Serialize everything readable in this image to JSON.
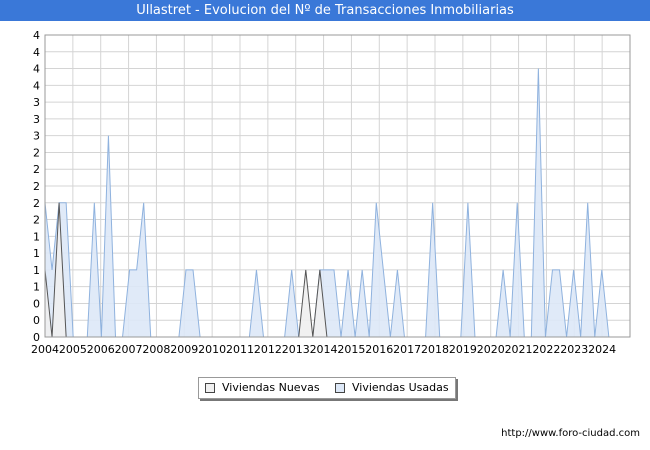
{
  "header": {
    "title": "Ullastret - Evolucion del Nº de Transacciones Inmobiliarias"
  },
  "legend": {
    "nuevas_label": "Viviendas Nuevas",
    "usadas_label": "Viviendas Usadas"
  },
  "footer": {
    "url": "http://www.foro-ciudad.com"
  },
  "colors": {
    "title_bg": "#3a78d8",
    "nuevas_fill": "#f0f0f0",
    "nuevas_stroke": "#555555",
    "usadas_fill": "#dde8f7",
    "usadas_stroke": "#8fb2de"
  },
  "chart_data": {
    "type": "area",
    "title": "Ullastret - Evolucion del Nº de Transacciones Inmobiliarias",
    "x_start_year": 2004,
    "x_end_year": 2024,
    "points_per_year": 4,
    "x_tick_labels": [
      "2004",
      "2005",
      "2006",
      "2007",
      "2008",
      "2009",
      "2010",
      "2011",
      "2012",
      "2013",
      "2014",
      "2015",
      "2016",
      "2017",
      "2018",
      "2019",
      "2020",
      "2021",
      "2022",
      "2023",
      "2024"
    ],
    "y_tick_labels": [
      "0",
      "0",
      "0",
      "1",
      "1",
      "1",
      "1",
      "2",
      "2",
      "2",
      "2",
      "2",
      "3",
      "3",
      "3",
      "4",
      "4",
      "4",
      "4"
    ],
    "ylim": [
      0,
      4.5
    ],
    "grid": true,
    "legend_position": "bottom-center",
    "series": [
      {
        "name": "Viviendas Nuevas",
        "values": [
          1,
          0,
          2,
          0,
          0,
          0,
          0,
          0,
          0,
          0,
          0,
          0,
          0,
          0,
          0,
          0,
          0,
          0,
          0,
          0,
          0,
          0,
          0,
          0,
          0,
          0,
          0,
          0,
          0,
          0,
          0,
          0,
          0,
          0,
          0,
          0,
          0,
          1,
          0,
          1,
          0,
          0,
          0,
          0,
          0,
          0,
          0,
          0,
          0,
          0,
          0,
          0,
          0,
          0,
          0,
          0,
          0,
          0,
          0,
          0,
          0,
          0,
          0,
          0,
          0,
          0,
          0,
          0,
          0,
          0,
          0,
          0,
          0,
          0,
          0,
          0,
          0,
          0,
          0,
          0,
          0,
          0,
          0,
          0
        ]
      },
      {
        "name": "Viviendas Usadas",
        "values": [
          2,
          1,
          2,
          2,
          0,
          0,
          0,
          2,
          0,
          3,
          0,
          0,
          1,
          1,
          2,
          0,
          0,
          0,
          0,
          0,
          1,
          1,
          0,
          0,
          0,
          0,
          0,
          0,
          0,
          0,
          1,
          0,
          0,
          0,
          0,
          1,
          0,
          0,
          0,
          1,
          1,
          1,
          0,
          1,
          0,
          1,
          0,
          2,
          1,
          0,
          1,
          0,
          0,
          0,
          0,
          2,
          0,
          0,
          0,
          0,
          2,
          0,
          0,
          0,
          0,
          1,
          0,
          2,
          0,
          0,
          4,
          0,
          1,
          1,
          0,
          1,
          0,
          2,
          0,
          1,
          0,
          0,
          0,
          0
        ]
      }
    ]
  }
}
